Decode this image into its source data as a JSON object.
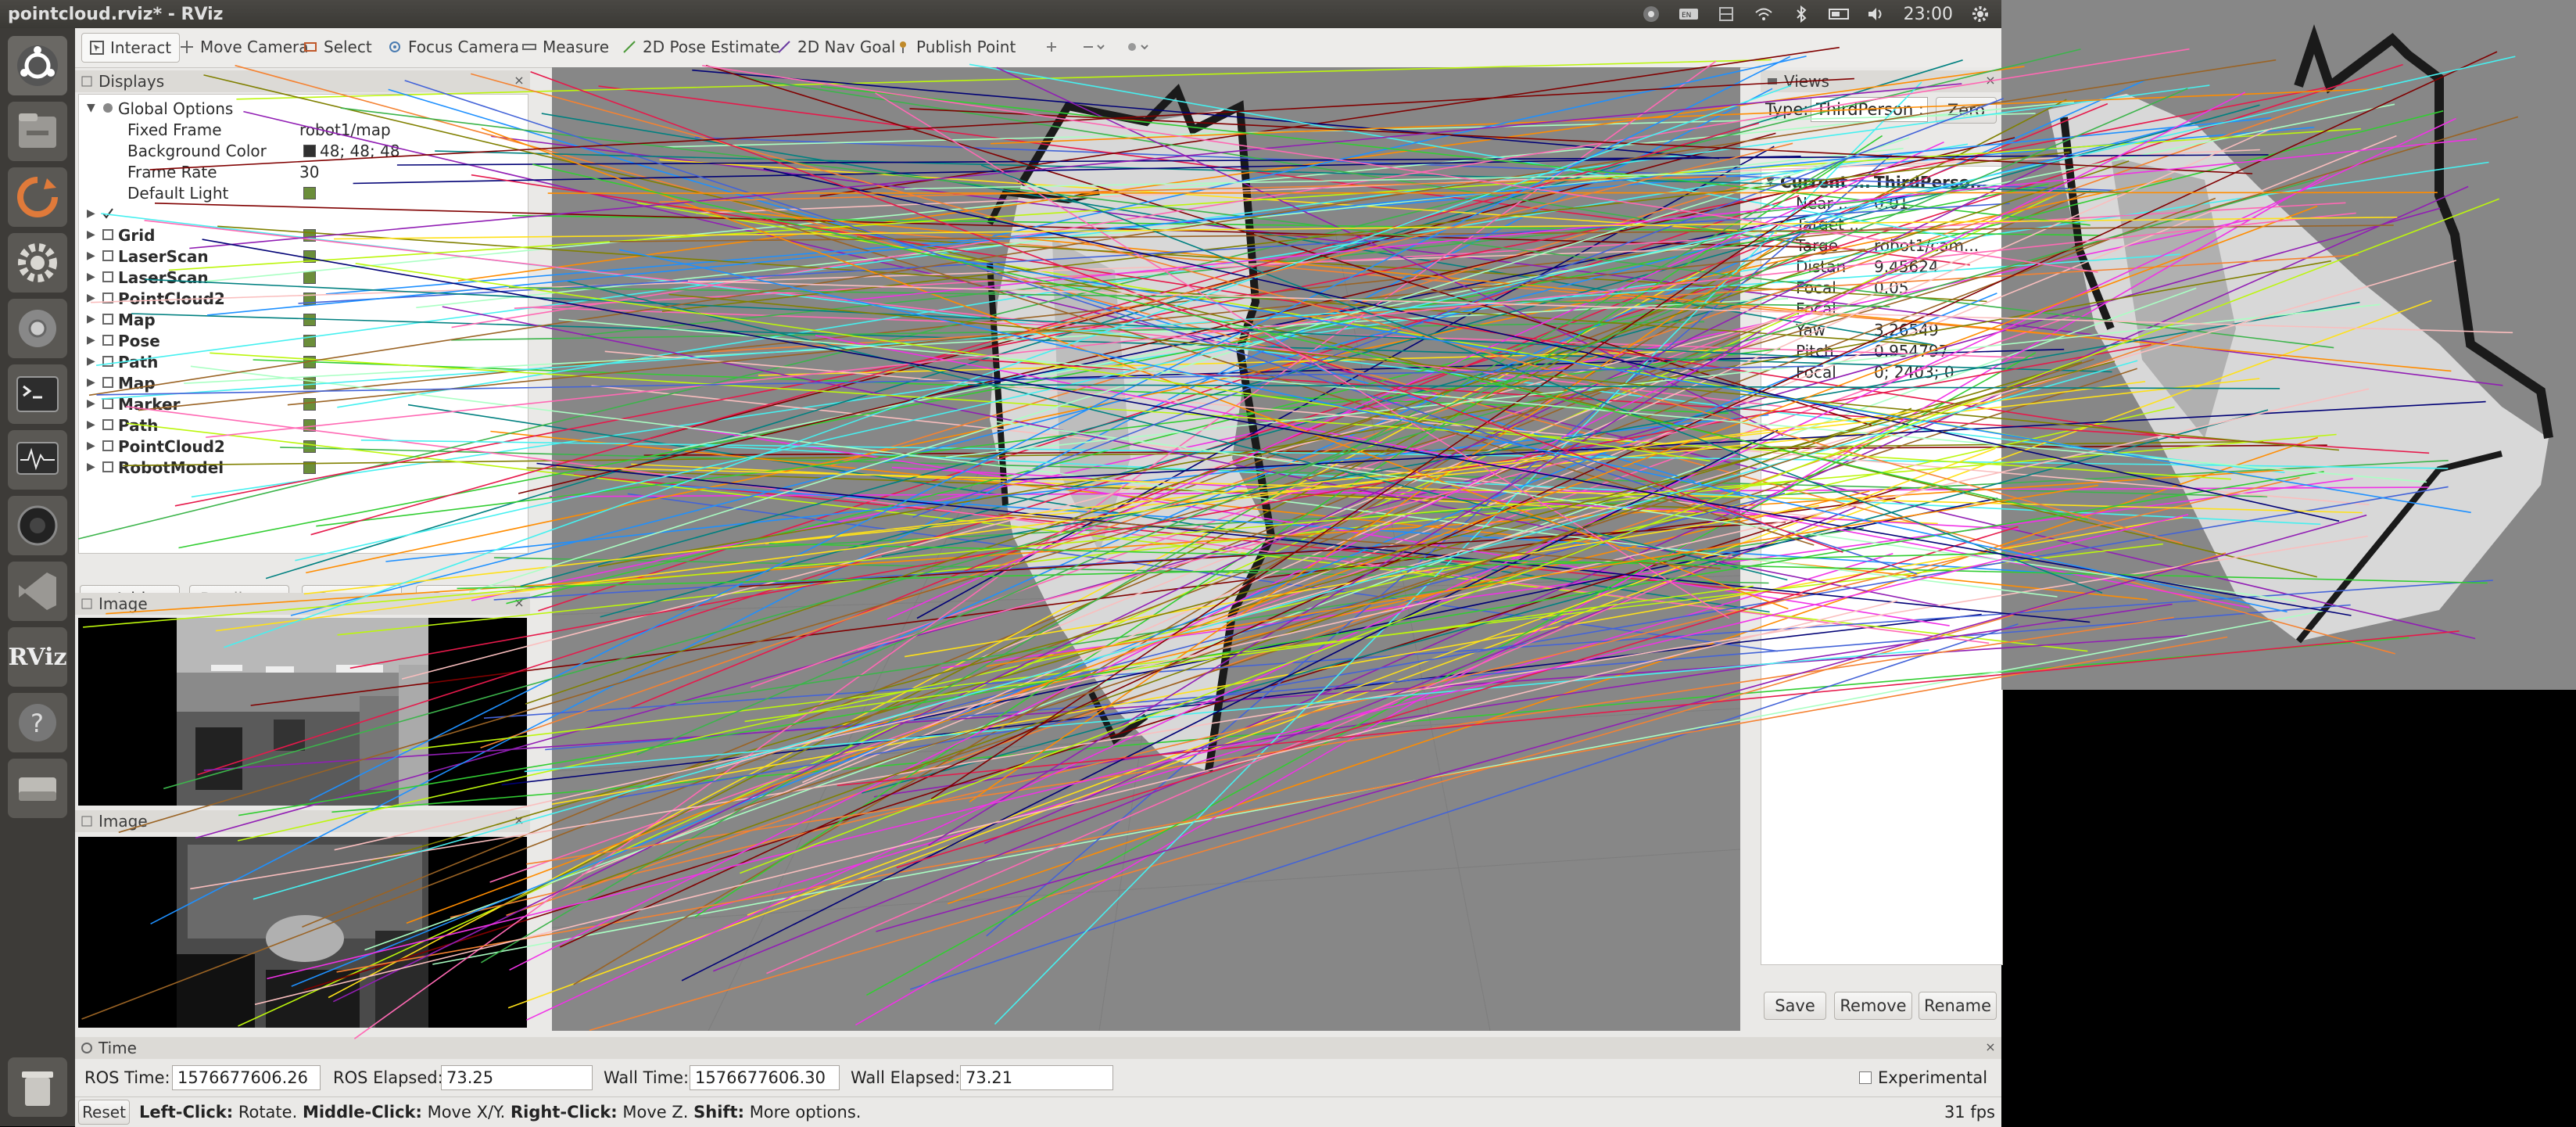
{
  "window": {
    "title": "pointcloud.rviz* - RViz",
    "clock": "23:00"
  },
  "tray_icons": [
    "chrome-icon",
    "keyboard-icon",
    "network-icon",
    "wifi-icon",
    "bluetooth-icon",
    "battery-icon",
    "volume-icon",
    "power-gear-icon"
  ],
  "launcher": [
    "ubuntu-dash-icon",
    "files-icon",
    "software-updater-icon",
    "system-settings-icon",
    "chrome-icon",
    "terminal-icon",
    "system-monitor-icon",
    "webcam-icon",
    "visual-studio-code-icon",
    "rviz-icon",
    "help-icon",
    "disk-icon",
    "trash-icon"
  ],
  "launcher_rviz_text": "RViz",
  "toolbar": {
    "tools": [
      "Interact",
      "Move Camera",
      "Select",
      "Focus Camera",
      "Measure",
      "2D Pose Estimate",
      "2D Nav Goal",
      "Publish Point"
    ]
  },
  "displays": {
    "title": "Displays",
    "global_options": "Global Options",
    "options": [
      {
        "name": "Fixed Frame",
        "value": "robot1/map"
      },
      {
        "name": "Background Color",
        "value": "48; 48; 48"
      },
      {
        "name": "Frame Rate",
        "value": "30"
      },
      {
        "name": "Default Light",
        "value": ""
      }
    ],
    "items": [
      "Grid",
      "LaserScan",
      "LaserScan",
      "PointCloud2",
      "Map",
      "Pose",
      "Path",
      "Map",
      "Marker",
      "Path",
      "PointCloud2",
      "RobotModel"
    ],
    "buttons": {
      "add": "Add",
      "duplicate": "Duplicate",
      "remove": "Remove",
      "rename": "Rename"
    }
  },
  "image_panel_1": {
    "title": "Image"
  },
  "image_panel_2": {
    "title": "Image"
  },
  "views": {
    "title": "Views",
    "type_label": "Type:",
    "type_value": "ThirdPerson :",
    "zero": "Zero",
    "current_label": "Current ...",
    "current_value": "ThirdPerso...",
    "props": [
      {
        "name": "Near ...",
        "value": "0.01"
      },
      {
        "name": "Target ...",
        "value": ""
      },
      {
        "name": "Targe",
        "value": "robot1/cam..."
      },
      {
        "name": "Distan",
        "value": "9.45624"
      },
      {
        "name": "Focal",
        "value": "0.05"
      },
      {
        "name": "Focal",
        "value": ""
      },
      {
        "name": "Yaw",
        "value": "3.26549"
      },
      {
        "name": "Pitch",
        "value": "0.954797"
      },
      {
        "name": "Focal",
        "value": "0; 2403; 0"
      }
    ],
    "buttons": {
      "save": "Save",
      "remove": "Remove",
      "rename": "Rename"
    }
  },
  "time": {
    "title": "Time",
    "ros_time_label": "ROS Time:",
    "ros_time": "1576677606.26",
    "ros_elapsed_label": "ROS Elapsed:",
    "ros_elapsed": "73.25",
    "wall_time_label": "Wall Time:",
    "wall_time": "1576677606.30",
    "wall_elapsed_label": "Wall Elapsed:",
    "wall_elapsed": "73.21",
    "experimental": "Experimental"
  },
  "status": {
    "reset": "Reset",
    "left_click": "Left-Click:",
    "left_click_desc": "Rotate.",
    "middle_click": "Middle-Click:",
    "middle_click_desc": "Move X/Y.",
    "right_click": "Right-Click:",
    "right_click_desc": "Move Z.",
    "shift": "Shift:",
    "shift_desc": "More options.",
    "fps": "31 fps"
  }
}
